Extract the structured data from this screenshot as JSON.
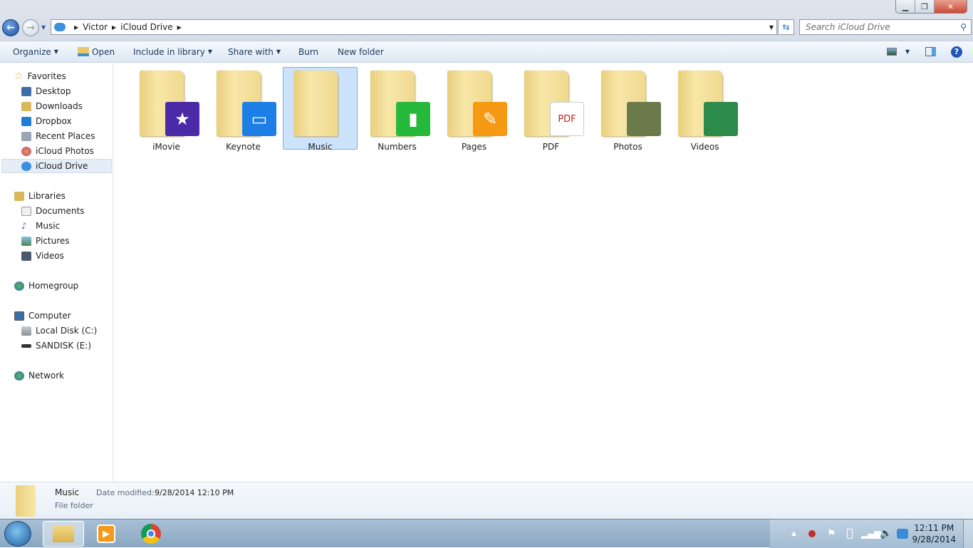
{
  "window": {
    "controls": [
      "minimize",
      "restore",
      "close"
    ]
  },
  "address": {
    "breadcrumb": [
      "Victor",
      "iCloud Drive"
    ],
    "search_placeholder": "Search iCloud Drive"
  },
  "toolbar": {
    "organize": "Organize",
    "open": "Open",
    "include": "Include in library",
    "share": "Share with",
    "burn": "Burn",
    "new_folder": "New folder"
  },
  "sidebar": {
    "favorites": {
      "label": "Favorites",
      "items": [
        {
          "label": "Desktop",
          "color": "#3b6ea8"
        },
        {
          "label": "Downloads",
          "color": "#d9b85a"
        },
        {
          "label": "Dropbox",
          "color": "#1f7fd8"
        },
        {
          "label": "Recent Places",
          "color": "#9aa6b4"
        },
        {
          "label": "iCloud Photos",
          "color": "#e5a03a"
        },
        {
          "label": "iCloud Drive",
          "color": "#3d8fe0",
          "selected": true
        }
      ]
    },
    "libraries": {
      "label": "Libraries",
      "items": [
        {
          "label": "Documents"
        },
        {
          "label": "Music"
        },
        {
          "label": "Pictures"
        },
        {
          "label": "Videos"
        }
      ]
    },
    "homegroup": {
      "label": "Homegroup"
    },
    "computer": {
      "label": "Computer",
      "items": [
        {
          "label": "Local Disk (C:)"
        },
        {
          "label": "SANDISK (E:)"
        }
      ]
    },
    "network": {
      "label": "Network"
    }
  },
  "folders": [
    {
      "name": "iMovie",
      "badge": "#4b2aa8",
      "glyph": "★"
    },
    {
      "name": "Keynote",
      "badge": "#1d7fe6",
      "glyph": "▭"
    },
    {
      "name": "Music",
      "badge": "",
      "glyph": "",
      "selected": true
    },
    {
      "name": "Numbers",
      "badge": "#25b83a",
      "glyph": "▮"
    },
    {
      "name": "Pages",
      "badge": "#f59a12",
      "glyph": "✎"
    },
    {
      "name": "PDF",
      "badge": "#ffffff",
      "glyph": "PDF"
    },
    {
      "name": "Photos",
      "badge": "#6b7a4a",
      "glyph": ""
    },
    {
      "name": "Videos",
      "badge": "#2c8a4a",
      "glyph": ""
    }
  ],
  "details": {
    "name": "Music",
    "date_label": "Date modified:",
    "date": "9/28/2014 12:10 PM",
    "type": "File folder"
  },
  "taskbar": {
    "time": "12:11 PM",
    "date": "9/28/2014"
  }
}
